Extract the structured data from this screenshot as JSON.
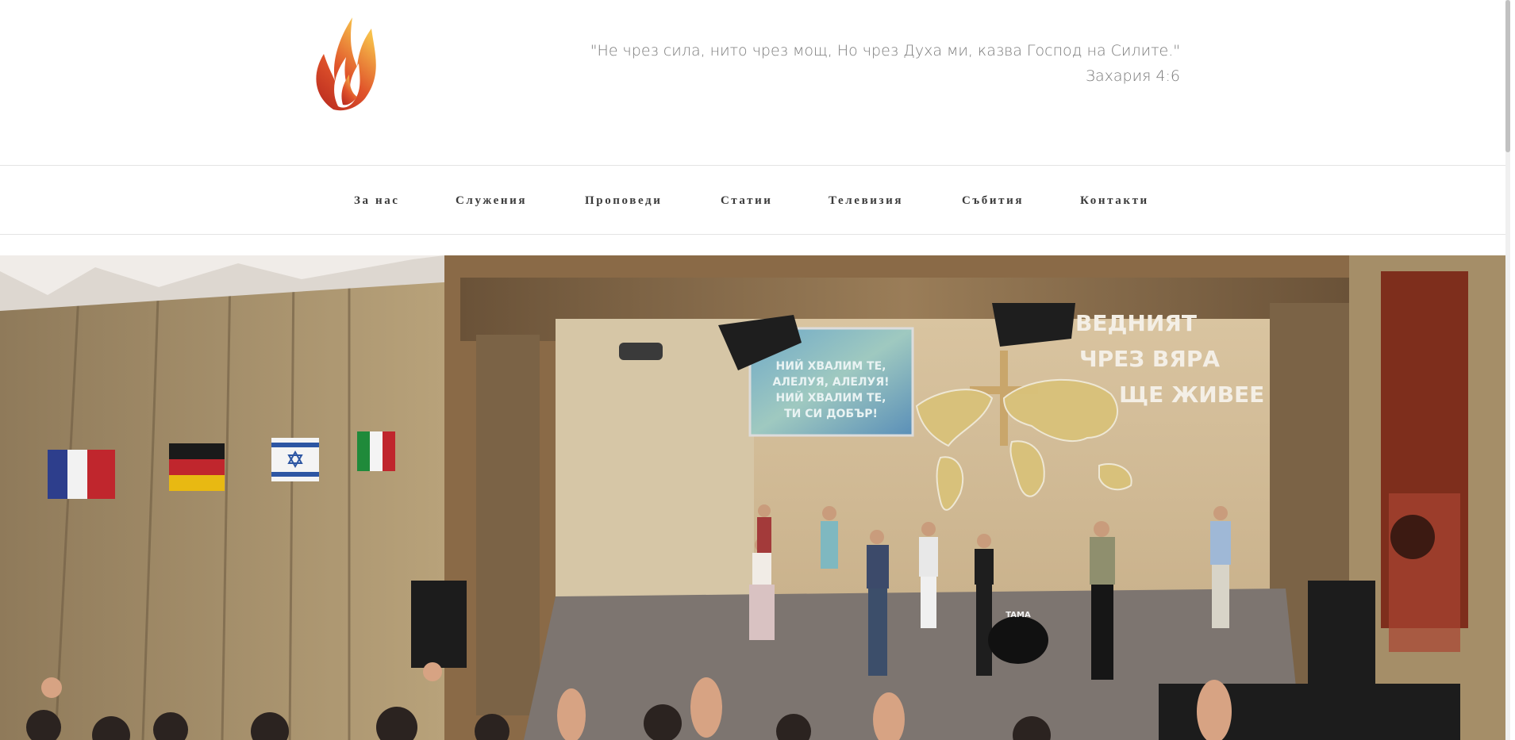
{
  "header": {
    "quote_line1": "\"Не чрез сила, нито чрез мощ, Но чрез Духа ми, казва Господ на Силите.\"",
    "quote_line2": "Захария 4:6",
    "logo_icon": "flame-icon"
  },
  "nav": {
    "items": [
      {
        "label": "За нас"
      },
      {
        "label": "Служения"
      },
      {
        "label": "Проповеди"
      },
      {
        "label": "Статии"
      },
      {
        "label": "Телевизия"
      },
      {
        "label": "Събития"
      },
      {
        "label": "Контакти"
      }
    ]
  },
  "hero": {
    "screen_lines": [
      "НИЙ ХВАЛИМ ТЕ,",
      "АЛЕЛУЯ, АЛЕЛУЯ!",
      "НИЙ ХВАЛИМ ТЕ,",
      "ТИ СИ ДОБЪР!"
    ],
    "wall_lines": [
      "ВЕДНИЯТ",
      "ЧРЕЗ ВЯРА",
      "ЩЕ ЖИВЕЕ"
    ],
    "drum_brand": "TAMA"
  },
  "colors": {
    "nav_text": "#3b3b3b",
    "quote_text": "#7a7a7a",
    "flame_dark": "#c0392b",
    "flame_light": "#f5b041"
  }
}
